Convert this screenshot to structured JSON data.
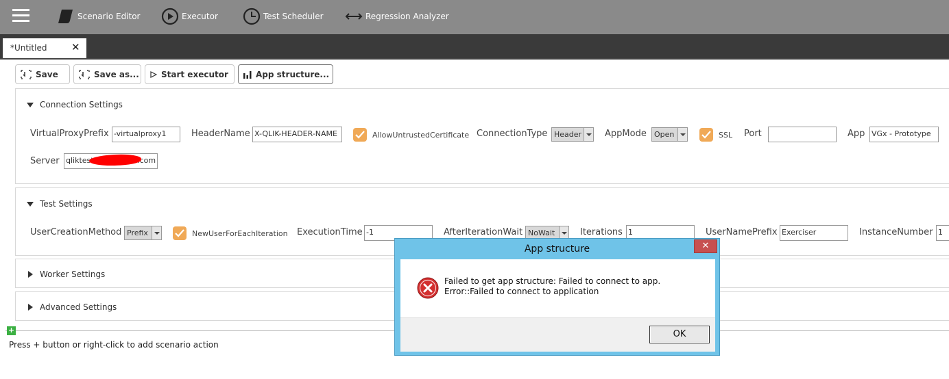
{
  "nav": {
    "items": [
      {
        "label": "Scenario Editor",
        "icon": "script-icon"
      },
      {
        "label": "Executor",
        "icon": "play-circle-icon"
      },
      {
        "label": "Test Scheduler",
        "icon": "clock-icon"
      },
      {
        "label": "Regression Analyzer",
        "icon": "arrows-horizontal-icon"
      }
    ]
  },
  "tab": {
    "label": "*Untitled",
    "close": "✕"
  },
  "toolbar": {
    "save": "Save",
    "save_as": "Save as...",
    "start_executor": "Start executor",
    "app_structure": "App structure..."
  },
  "connection": {
    "title": "Connection Settings",
    "virtual_proxy_prefix_label": "VirtualProxyPrefix",
    "virtual_proxy_prefix_value": "-virtualproxy1",
    "header_name_label": "HeaderName",
    "header_name_value": "X-QLIK-HEADER-NAME",
    "allow_untrusted_label": "AllowUntrustedCertificate",
    "allow_untrusted_checked": true,
    "connection_type_label": "ConnectionType",
    "connection_type_value": "Header",
    "app_mode_label": "AppMode",
    "app_mode_value": "Open",
    "ssl_label": "SSL",
    "ssl_checked": true,
    "port_label": "Port",
    "port_value": "",
    "app_label": "App",
    "app_value": "VGx - Prototype",
    "server_label": "Server",
    "server_value_prefix": "qliktest.",
    "server_value_suffix": ".com"
  },
  "test": {
    "title": "Test Settings",
    "user_creation_label": "UserCreationMethod",
    "user_creation_value": "Prefix",
    "new_user_label": "NewUserForEachIteration",
    "new_user_checked": true,
    "execution_time_label": "ExecutionTime",
    "execution_time_value": "-1",
    "after_iteration_wait_label": "AfterIterationWait",
    "after_iteration_wait_value": "NoWait",
    "iterations_label": "Iterations",
    "iterations_value": "1",
    "user_name_prefix_label": "UserNamePrefix",
    "user_name_prefix_value": "Exerciser",
    "instance_number_label": "InstanceNumber",
    "instance_number_value": "1"
  },
  "worker": {
    "title": "Worker Settings"
  },
  "advanced": {
    "title": "Advanced Settings"
  },
  "scenario": {
    "add_symbol": "+",
    "hint": "Press + button or right-click to add scenario action"
  },
  "dialog": {
    "title": "App structure",
    "close": "✕",
    "message": "Failed to get app structure: Failed to connect to app. Error::Failed to connect to application",
    "ok": "OK"
  },
  "colors": {
    "topbar": "#8a8a8a",
    "tabstrip": "#3a3a3a",
    "checkbox": "#f0a957",
    "dialog_frame": "#6fc3e8",
    "dialog_close": "#c75050",
    "error_icon": "#d32f2f",
    "add_button": "#3cb043"
  }
}
